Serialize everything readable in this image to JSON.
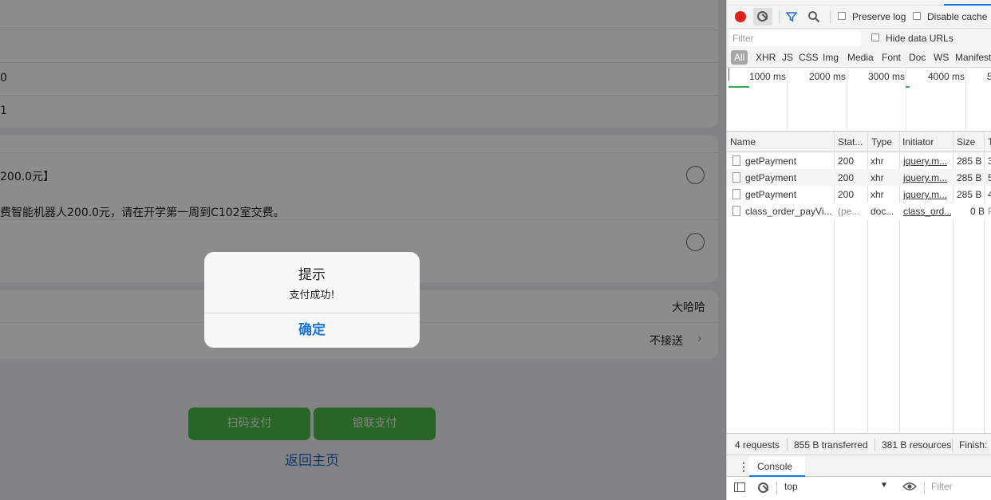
{
  "mobile": {
    "row1_text": "0",
    "row2_text": "1",
    "option1_text": "200.0元】",
    "option1_desc": "费智能机器人200.0元，请在开学第一周到C102室交费。",
    "name_value": "大哈哈",
    "pickup_value": "不接送",
    "scan_pay_label": "扫码支付",
    "bank_pay_label": "银联支付",
    "back_home_label": "返回主页"
  },
  "dialog": {
    "title": "提示",
    "message": "支付成功!",
    "confirm_label": "确定"
  },
  "devtools": {
    "preserve_log_label": "Preserve log",
    "disable_cache_label": "Disable cache",
    "filter_placeholder": "Filter",
    "hide_data_urls_label": "Hide data URLs",
    "type_filters": [
      "All",
      "XHR",
      "JS",
      "CSS",
      "Img",
      "Media",
      "Font",
      "Doc",
      "WS",
      "Manifest"
    ],
    "timeline_ticks": [
      "1000 ms",
      "2000 ms",
      "3000 ms",
      "4000 ms",
      "5"
    ],
    "columns": [
      "Name",
      "Stat...",
      "Type",
      "Initiator",
      "Size",
      "T"
    ],
    "requests": [
      {
        "name": "getPayment",
        "status": "200",
        "type": "xhr",
        "initiator": "jquery.m...",
        "size": "285 B",
        "time": "3"
      },
      {
        "name": "getPayment",
        "status": "200",
        "type": "xhr",
        "initiator": "jquery.m...",
        "size": "285 B",
        "time": "5"
      },
      {
        "name": "getPayment",
        "status": "200",
        "type": "xhr",
        "initiator": "jquery.m...",
        "size": "285 B",
        "time": "4"
      },
      {
        "name": "class_order_payVi...",
        "status": "(pe...",
        "type": "doc...",
        "initiator": "class_ord...",
        "size": "0 B",
        "time": "P"
      }
    ],
    "status_bar": {
      "requests": "4 requests",
      "transferred": "855 B transferred",
      "resources": "381 B resources",
      "finish": "Finish:"
    },
    "drawer_tab_label": "Console",
    "context_value": "top",
    "console_filter_placeholder": "Filter"
  },
  "colors": {
    "pay_button": "#4cb847",
    "link": "#1d63c7",
    "dialog_confirm": "#1a73d9",
    "record": "#e0201d"
  }
}
